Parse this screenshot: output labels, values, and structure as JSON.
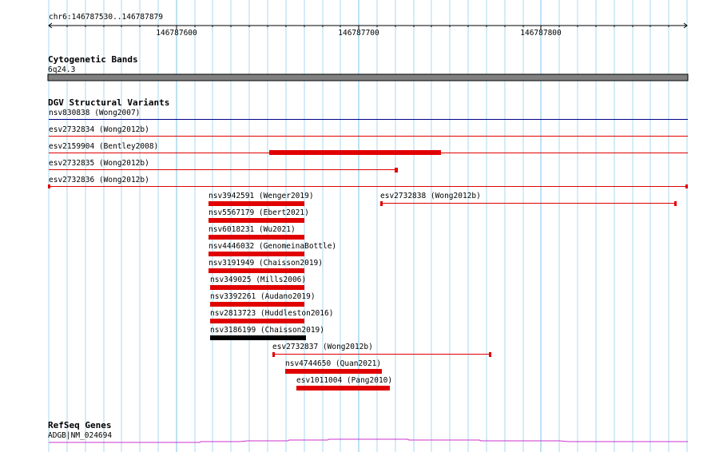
{
  "ruler": {
    "location": "chr6:146787530..146787879",
    "ticks": [
      "146787600",
      "146787700",
      "146787800"
    ]
  },
  "cytoband": {
    "title": "Cytogenetic Bands",
    "band": "6q24.3"
  },
  "dgv": {
    "title": "DGV Structural Variants",
    "features": [
      {
        "label": "nsv830838 (Wong2007)",
        "color": "#00008b",
        "style": "line"
      },
      {
        "label": "esv2732834 (Wong2012b)",
        "color": "#e00000",
        "style": "line"
      },
      {
        "label": "esv2159904 (Bentley2008)",
        "color": "#e00000",
        "style": "line+block"
      },
      {
        "label": "esv2732835 (Wong2012b)",
        "color": "#e00000",
        "style": "line"
      },
      {
        "label": "esv2732836 (Wong2012b)",
        "color": "#e00000",
        "style": "line"
      },
      {
        "label": "nsv3942591 (Wenger2019)",
        "color": "#e00000",
        "style": "block"
      },
      {
        "label": "esv2732838 (Wong2012b)",
        "color": "#e00000",
        "style": "line"
      },
      {
        "label": "nsv5567179 (Ebert2021)",
        "color": "#e00000",
        "style": "block"
      },
      {
        "label": "nsv6018231 (Wu2021)",
        "color": "#e00000",
        "style": "block"
      },
      {
        "label": "nsv4446032 (GenomeinaBottle)",
        "color": "#e00000",
        "style": "block"
      },
      {
        "label": "nsv3191949 (Chaisson2019)",
        "color": "#e00000",
        "style": "block"
      },
      {
        "label": "nsv349025 (Mills2006)",
        "color": "#e00000",
        "style": "block"
      },
      {
        "label": "nsv3392261 (Audano2019)",
        "color": "#e00000",
        "style": "block"
      },
      {
        "label": "nsv2813723 (Huddleston2016)",
        "color": "#e00000",
        "style": "block"
      },
      {
        "label": "nsv3186199 (Chaisson2019)",
        "color": "#000000",
        "style": "block"
      },
      {
        "label": "esv2732837 (Wong2012b)",
        "color": "#e00000",
        "style": "line"
      },
      {
        "label": "nsv4744650 (Quan2021)",
        "color": "#e00000",
        "style": "block"
      },
      {
        "label": "esv1011004 (Pang2010)",
        "color": "#e00000",
        "style": "block"
      }
    ]
  },
  "refseq": {
    "title": "RefSeq Genes",
    "gene": "ADGB|NM_024694",
    "color": "#cc33cc"
  }
}
